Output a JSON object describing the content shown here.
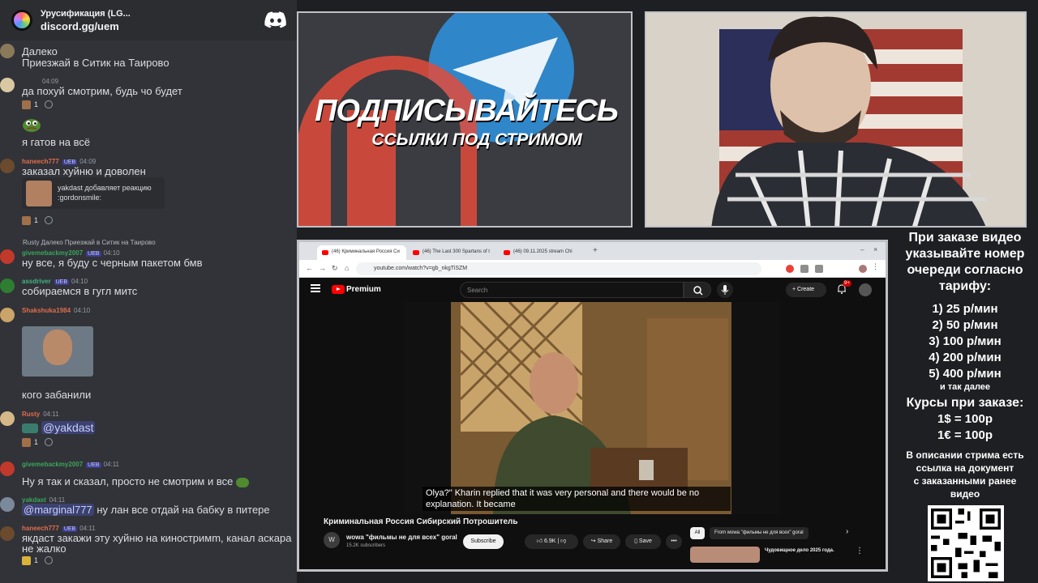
{
  "server": {
    "name": "Урусификация (LG...",
    "invite": "discord.gg/uem"
  },
  "messages": [
    {
      "text": "Далеко"
    },
    {
      "text": "Приезжай в Ситик на Таирово"
    },
    {
      "time": "04:09",
      "text": "да похуй смотрим, будь чо будет",
      "reaction_count": "1"
    },
    {
      "text": "я гатов на всё"
    },
    {
      "user": "haneech777",
      "tag": "UEB",
      "time": "04:09",
      "text": "заказал хуйню и доволен",
      "reaction_count": "1"
    },
    {
      "reply": "Rusty Далеко Приезжай в Ситик на Таирово",
      "user": "givemebackmy2007",
      "tag": "UEB",
      "time": "04:10",
      "text": "ну все, я буду с черным пакетом бмв"
    },
    {
      "user": "assdriver",
      "tag": "UEB",
      "time": "04:10",
      "text": "собираемся в гугл митс"
    },
    {
      "user": "Shakshuka1984",
      "time": "04:10",
      "text": "кого забанили"
    },
    {
      "user": "Rusty",
      "time": "04:11",
      "text": "@yakdast",
      "reaction_count": "1"
    },
    {
      "user": "givemebackmy2007",
      "tag": "UEB",
      "time": "04:11",
      "text": "Ну я так и сказал, просто не смотрим и все"
    },
    {
      "user": "yakdast",
      "time": "04:11",
      "mention": "@marginal777",
      "text": "ну лан все отдай на бабку в питере"
    },
    {
      "user": "haneech777",
      "tag": "UEB",
      "time": "04:11",
      "text": "якдаст закажи эту хуйню на киностримm, канал аскара",
      "text2": "не жалко",
      "reaction_count": "1"
    }
  ],
  "reaction_notice": {
    "line1": "yakdast добавляет реакцию",
    "line2": ":gordonsmile:"
  },
  "poster": {
    "title": "ПОДПИСЫВАЙТЕСЬ",
    "subtitle": "ССЫЛКИ ПОД СТРИМОМ"
  },
  "browser": {
    "tabs": [
      "(46) Криминальная Россия Си",
      "(46) The Last 300 Spartans of t",
      "(46) 09.11.2025 stream Chi"
    ],
    "url": "youtube.com/watch?v=gb_nkgTiSZM"
  },
  "youtube": {
    "brand": "Premium",
    "search_placeholder": "Search",
    "create_label": "+ Create",
    "notif_badge": "9+",
    "subtitle_text": "Olya?\" Kharin replied that it was very personal and there would be no explanation. It became",
    "video_title": "Криминальная Россия Сибирский Потрошитель",
    "channel_initial": "W",
    "channel_name": "wowa \"фильмы не для всех\" goral",
    "channel_subs": "15.2K subscribers",
    "subscribe_label": "Subscribe",
    "likes": "6.9K",
    "share_label": "Share",
    "save_label": "Save",
    "more_label": "•••",
    "filter_all": "All",
    "filter_from": "From wowa \"фильмы не для всех\" goral",
    "rec_title": "Чудовищное дело 2025 года."
  },
  "info_panel": {
    "heading": [
      "При заказе видео",
      "указывайте номер",
      "очереди согласно",
      "тарифу:"
    ],
    "prices": [
      "1) 25 р/мин",
      "2) 50 р/мин",
      "3) 100 р/мин",
      "4) 200 р/мин",
      "5) 400 р/мин"
    ],
    "etc": "и так далее",
    "rates_heading": "Курсы при заказе:",
    "rates": [
      "1$ = 100р",
      "1€ = 100р"
    ],
    "description": [
      "В описании стрима есть",
      "ссылка на документ",
      "с заказанными ранее",
      "видео"
    ]
  },
  "colors": {
    "discord_bg": "#313338",
    "youtube_red": "#ff0000",
    "stage_bg": "#1e1f22"
  }
}
